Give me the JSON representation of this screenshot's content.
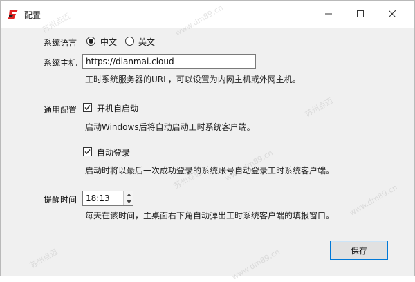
{
  "window": {
    "title": "配置",
    "icons": {
      "app": "app-logo-icon",
      "minimize": "minimize-icon",
      "maximize": "maximize-icon",
      "close": "close-icon"
    }
  },
  "language": {
    "label": "系统语言",
    "options": [
      {
        "label": "中文",
        "selected": true
      },
      {
        "label": "英文",
        "selected": false
      }
    ]
  },
  "host": {
    "label": "系统主机",
    "value": "https://dianmai.cloud",
    "hint": "工时系统服务器的URL，可以设置为内网主机或外网主机。"
  },
  "general": {
    "label": "通用配置",
    "autostart": {
      "label": "开机自启动",
      "checked": true,
      "hint": "启动Windows后将自动启动工时系统客户端。"
    },
    "autologin": {
      "label": "自动登录",
      "checked": true,
      "hint": "启动时将以最后一次成功登录的系统账号自动登录工时系统客户端。"
    }
  },
  "reminder": {
    "label": "提醒时间",
    "value": "18:13",
    "hint": "每天在该时间，主桌面右下角自动弹出工时系统客户端的填报窗口。"
  },
  "actions": {
    "save_label": "保存"
  },
  "watermarks": [
    "苏州点迈",
    "www.dm89.cn"
  ],
  "colors": {
    "accent": "#0078d7",
    "window_bg": "#f0f0f0",
    "logo": "#e02020"
  }
}
